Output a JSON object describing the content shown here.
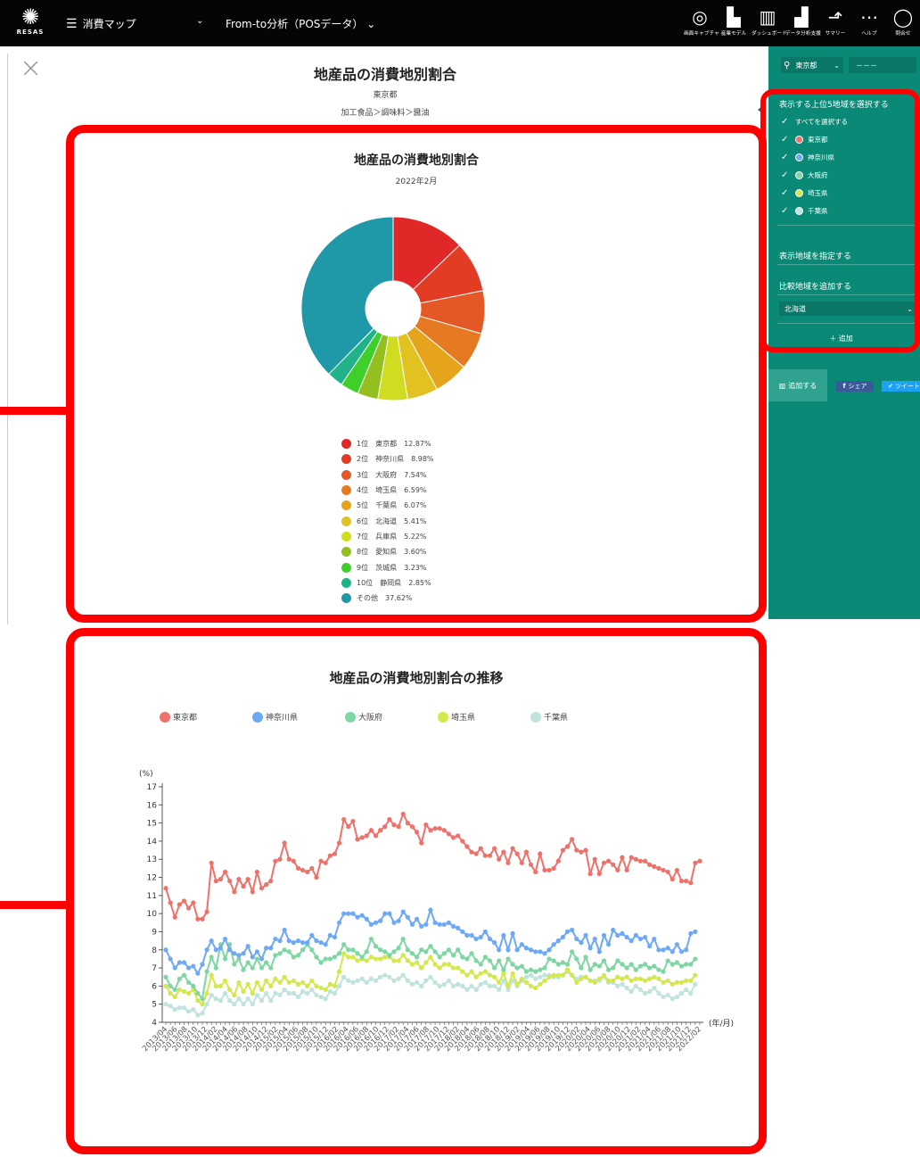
{
  "header": {
    "logo_text": "RESAS",
    "menu_label": "消費マップ",
    "menu_caret": "⌄",
    "submenu_label": "From-to分析（POSデータ） ⌄",
    "tools": [
      {
        "icon": "camera-icon",
        "glyph": "◎",
        "label": "画面キャプチャ"
      },
      {
        "icon": "industry-model-icon",
        "glyph": "▙",
        "label": "産業モデル"
      },
      {
        "icon": "dashboard-icon",
        "glyph": "▥",
        "label": "ダッシュボード"
      },
      {
        "icon": "data-analysis-icon",
        "glyph": "▟",
        "label": "データ分析支援"
      },
      {
        "icon": "summary-icon",
        "glyph": "⬏",
        "label": "サマリー"
      },
      {
        "icon": "help-icon",
        "glyph": "⋯",
        "label": "ヘルプ"
      },
      {
        "icon": "contact-icon",
        "glyph": "◯",
        "label": "問合せ"
      }
    ]
  },
  "page": {
    "close_glyph": "×",
    "title": "地産品の消費地別割合",
    "prefecture": "東京都",
    "breadcrumb": "加工食品＞調味料＞醤油"
  },
  "pie_panel": {
    "title": "地産品の消費地別割合",
    "subtitle": "2022年2月"
  },
  "line_panel": {
    "title": "地産品の消費地別割合の推移"
  },
  "sidebar": {
    "region_icon": "location-pin-icon",
    "region_value": "東京都",
    "region_caret": "⌄",
    "region2_value": "－－－",
    "top5_heading": "表示する上位5地域を選択する",
    "select_all": "すべてを選択する",
    "checkmark": "✓",
    "regions": [
      {
        "name": "東京都",
        "color": "#f0706a"
      },
      {
        "name": "神奈川県",
        "color": "#6fa8f5"
      },
      {
        "name": "大阪府",
        "color": "#7ed6a2"
      },
      {
        "name": "埼玉県",
        "color": "#d4e84a"
      },
      {
        "name": "千葉県",
        "color": "#bfe3dd"
      }
    ],
    "specify_heading": "表示地域を指定する",
    "compare_heading": "比較地域を追加する",
    "compare_select": "北海道",
    "compare_caret": "⌄",
    "add_label": "＋ 追加",
    "add_button": "追加する",
    "share_button": "シェア",
    "tweet_button": "ツイート",
    "share_icon": "f",
    "tweet_icon": "✔"
  },
  "chart_data": [
    {
      "type": "pie",
      "title": "地産品の消費地別割合",
      "subtitle": "2022年2月",
      "donut": true,
      "slices": [
        {
          "rank": "1位",
          "label": "東京都",
          "value": 12.87,
          "display": "12.87%",
          "color": "#e02828"
        },
        {
          "rank": "2位",
          "label": "神奈川県",
          "value": 8.98,
          "display": "8.98%",
          "color": "#e23c25"
        },
        {
          "rank": "3位",
          "label": "大阪府",
          "value": 7.54,
          "display": "7.54%",
          "color": "#e45826"
        },
        {
          "rank": "4位",
          "label": "埼玉県",
          "value": 6.59,
          "display": "6.59%",
          "color": "#e57a22"
        },
        {
          "rank": "5位",
          "label": "千葉県",
          "value": 6.07,
          "display": "6.07%",
          "color": "#e6a41d"
        },
        {
          "rank": "6位",
          "label": "北海道",
          "value": 5.41,
          "display": "5.41%",
          "color": "#e1c220"
        },
        {
          "rank": "7位",
          "label": "兵庫県",
          "value": 5.22,
          "display": "5.22%",
          "color": "#cfdc1f"
        },
        {
          "rank": "8位",
          "label": "愛知県",
          "value": 3.6,
          "display": "3.60%",
          "color": "#93c01f"
        },
        {
          "rank": "9位",
          "label": "茨城県",
          "value": 3.23,
          "display": "3.23%",
          "color": "#3fcf2a"
        },
        {
          "rank": "10位",
          "label": "静岡県",
          "value": 2.85,
          "display": "2.85%",
          "color": "#21b28a"
        },
        {
          "rank": "",
          "label": "その他",
          "value": 37.62,
          "display": "37.62%",
          "color": "#1f98a8"
        }
      ]
    },
    {
      "type": "line",
      "title": "地産品の消費地別割合の推移",
      "ylabel": "(%)",
      "xlabel": "(年/月)",
      "ylim": [
        4,
        17
      ],
      "yticks": [
        4,
        5,
        6,
        7,
        8,
        9,
        10,
        11,
        12,
        13,
        14,
        15,
        16,
        17
      ],
      "x_tick_labels": [
        "2013/04",
        "2013/06",
        "2013/08",
        "2013/10",
        "2013/12",
        "2014/02",
        "2014/04",
        "2014/06",
        "2014/08",
        "2014/10",
        "2014/12",
        "2015/02",
        "2015/04",
        "2015/06",
        "2015/08",
        "2015/10",
        "2015/12",
        "2016/02",
        "2016/04",
        "2016/06",
        "2016/08",
        "2016/10",
        "2016/12",
        "2017/02",
        "2017/04",
        "2017/06",
        "2017/08",
        "2017/10",
        "2017/12",
        "2018/02",
        "2018/04",
        "2018/06",
        "2018/08",
        "2018/10",
        "2018/12",
        "2019/02",
        "2019/04",
        "2019/06",
        "2019/08",
        "2019/10",
        "2019/12",
        "2020/02",
        "2020/04",
        "2020/06",
        "2020/08",
        "2020/10",
        "2020/12",
        "2021/02",
        "2021/04",
        "2021/06",
        "2021/08",
        "2021/10",
        "2021/12",
        "2022/02"
      ],
      "series": [
        {
          "name": "東京都",
          "color": "#f0706a",
          "values": [
            11.4,
            10.6,
            9.8,
            10.5,
            10.7,
            10.3,
            10.6,
            9.7,
            9.7,
            10.1,
            12.8,
            11.8,
            11.9,
            12.3,
            11.8,
            11.2,
            11.9,
            11.5,
            11.9,
            11.2,
            12.3,
            11.4,
            11.6,
            11.8,
            12.9,
            13.0,
            13.9,
            13.0,
            12.9,
            12.5,
            12.4,
            12.3,
            12.5,
            12.0,
            12.9,
            12.8,
            13.2,
            13.3,
            13.9,
            15.2,
            14.8,
            15.1,
            14.1,
            14.2,
            14.3,
            14.6,
            14.3,
            14.6,
            14.8,
            15.2,
            14.9,
            14.8,
            15.5,
            15.0,
            14.8,
            14.5,
            13.9,
            14.9,
            14.6,
            14.7,
            14.7,
            14.6,
            14.4,
            14.2,
            14.3,
            14.0,
            13.7,
            13.4,
            13.3,
            13.6,
            13.2,
            13.2,
            13.6,
            13.0,
            13.4,
            12.8,
            13.6,
            13.3,
            12.8,
            13.4,
            12.7,
            12.3,
            13.3,
            12.4,
            12.4,
            12.5,
            12.9,
            13.5,
            13.7,
            14.1,
            13.5,
            13.4,
            13.5,
            12.2,
            13.0,
            12.2,
            12.8,
            12.9,
            12.7,
            12.4,
            13.1,
            12.4,
            13.1,
            13.0,
            12.9,
            12.9,
            12.7,
            12.6,
            12.5,
            12.4,
            12.3,
            11.9,
            12.4,
            11.8,
            11.8,
            11.7,
            12.8,
            12.9
          ]
        },
        {
          "name": "神奈川県",
          "color": "#6fa8f5",
          "values": [
            8.0,
            7.5,
            7.0,
            7.3,
            7.3,
            7.0,
            7.1,
            6.7,
            7.2,
            8.0,
            8.5,
            8.0,
            8.1,
            8.6,
            8.0,
            7.8,
            7.7,
            7.8,
            8.2,
            7.6,
            7.9,
            7.5,
            8.1,
            8.1,
            8.6,
            8.5,
            9.1,
            8.5,
            8.4,
            8.5,
            8.4,
            8.4,
            8.8,
            8.5,
            8.4,
            8.3,
            8.8,
            8.7,
            9.5,
            10.0,
            10.0,
            10.0,
            9.8,
            9.9,
            9.7,
            9.4,
            9.5,
            9.6,
            10.0,
            10.0,
            9.5,
            9.6,
            10.1,
            9.8,
            9.4,
            9.7,
            9.3,
            9.4,
            10.2,
            9.5,
            9.4,
            9.4,
            9.5,
            9.3,
            9.2,
            9.0,
            8.8,
            8.8,
            8.6,
            8.7,
            9.0,
            8.6,
            8.4,
            8.0,
            8.8,
            8.0,
            8.9,
            8.0,
            8.3,
            8.1,
            8.0,
            7.9,
            7.9,
            7.8,
            8.0,
            8.3,
            8.5,
            8.7,
            9.0,
            9.1,
            8.6,
            8.4,
            8.8,
            8.1,
            8.6,
            7.9,
            8.8,
            8.3,
            9.1,
            8.8,
            8.9,
            8.7,
            8.5,
            8.8,
            8.6,
            8.7,
            8.2,
            8.6,
            8.0,
            8.0,
            8.1,
            7.9,
            8.3,
            7.9,
            8.0,
            8.9,
            9.0
          ]
        },
        {
          "name": "大阪府",
          "color": "#7ed6a2",
          "values": [
            6.5,
            6.0,
            5.8,
            6.4,
            6.6,
            6.2,
            6.0,
            5.6,
            5.3,
            6.8,
            7.6,
            7.0,
            8.3,
            7.5,
            8.3,
            7.2,
            7.5,
            6.9,
            7.3,
            7.0,
            7.5,
            7.0,
            7.3,
            7.0,
            7.7,
            7.8,
            8.0,
            7.9,
            7.6,
            7.7,
            8.0,
            8.3,
            8.0,
            7.6,
            7.3,
            7.5,
            7.5,
            7.6,
            7.8,
            8.3,
            8.0,
            8.0,
            7.8,
            7.6,
            7.9,
            8.6,
            8.2,
            8.0,
            7.9,
            7.7,
            7.9,
            8.1,
            8.6,
            8.0,
            7.8,
            7.6,
            8.0,
            7.9,
            8.2,
            7.9,
            7.6,
            7.8,
            8.0,
            7.7,
            8.0,
            7.6,
            7.5,
            7.8,
            7.4,
            7.2,
            7.6,
            7.4,
            7.0,
            7.4,
            6.9,
            7.5,
            7.2,
            7.0,
            7.1,
            6.8,
            6.9,
            6.8,
            6.9,
            7.0,
            7.5,
            7.4,
            7.2,
            7.3,
            7.2,
            7.9,
            7.5,
            7.0,
            7.6,
            6.9,
            7.2,
            7.1,
            7.4,
            6.9,
            7.0,
            7.4,
            7.2,
            7.0,
            7.2,
            6.9,
            7.1,
            7.2,
            7.0,
            7.1,
            6.9,
            6.8,
            7.4,
            7.2,
            7.3,
            7.1,
            7.2,
            7.2,
            7.5
          ]
        },
        {
          "name": "埼玉県",
          "color": "#d4e84a",
          "values": [
            6.0,
            5.6,
            5.4,
            5.8,
            5.7,
            5.6,
            5.8,
            5.2,
            5.0,
            5.6,
            6.6,
            6.0,
            6.0,
            6.3,
            5.8,
            5.5,
            6.2,
            5.7,
            6.1,
            5.6,
            6.2,
            5.8,
            6.3,
            6.0,
            6.4,
            6.2,
            6.5,
            6.2,
            6.3,
            6.1,
            6.2,
            6.0,
            6.3,
            6.0,
            5.9,
            5.8,
            6.1,
            6.0,
            6.8,
            7.8,
            7.6,
            7.6,
            7.4,
            7.5,
            7.4,
            7.6,
            7.5,
            7.5,
            7.6,
            7.6,
            7.4,
            7.4,
            7.7,
            7.4,
            7.2,
            7.3,
            7.0,
            7.3,
            7.6,
            7.2,
            7.0,
            7.2,
            7.2,
            7.0,
            7.0,
            6.8,
            6.6,
            6.8,
            6.5,
            6.7,
            6.8,
            6.6,
            6.5,
            6.2,
            6.7,
            6.0,
            6.7,
            6.1,
            6.4,
            6.2,
            6.0,
            5.9,
            6.1,
            6.3,
            6.5,
            6.6,
            6.6,
            6.6,
            6.9,
            6.6,
            6.2,
            6.4,
            6.5,
            6.3,
            6.2,
            6.4,
            6.6,
            6.3,
            6.3,
            6.5,
            6.4,
            6.5,
            6.3,
            6.4,
            6.4,
            6.3,
            6.4,
            6.5,
            6.4,
            6.2,
            6.3,
            6.1,
            6.2,
            6.2,
            6.3,
            6.3,
            6.6
          ]
        },
        {
          "name": "千葉県",
          "color": "#bfe3dd",
          "values": [
            5.0,
            4.9,
            4.7,
            4.8,
            4.8,
            4.6,
            4.7,
            4.4,
            4.5,
            5.0,
            5.5,
            5.3,
            5.2,
            5.6,
            5.2,
            5.0,
            5.3,
            5.0,
            5.3,
            5.0,
            5.5,
            5.2,
            5.6,
            5.2,
            5.6,
            5.5,
            5.8,
            5.6,
            5.6,
            5.4,
            5.7,
            5.6,
            5.8,
            5.5,
            5.4,
            5.3,
            5.7,
            5.6,
            6.0,
            6.5,
            6.3,
            6.2,
            6.3,
            6.4,
            6.2,
            6.4,
            6.3,
            6.5,
            6.6,
            6.5,
            6.3,
            6.4,
            6.6,
            6.3,
            6.1,
            6.2,
            6.0,
            6.3,
            6.5,
            6.2,
            6.0,
            6.1,
            6.3,
            6.0,
            6.1,
            6.0,
            5.8,
            6.0,
            5.8,
            6.1,
            6.2,
            6.0,
            6.0,
            5.8,
            6.3,
            5.8,
            6.3,
            6.0,
            6.3,
            6.5,
            6.6,
            6.4,
            6.5,
            6.6,
            6.6,
            6.5,
            6.5,
            6.6,
            6.8,
            6.6,
            6.4,
            6.5,
            6.5,
            6.3,
            6.3,
            6.3,
            6.5,
            6.2,
            6.2,
            6.0,
            6.1,
            5.9,
            5.7,
            6.0,
            5.8,
            5.6,
            5.7,
            5.9,
            5.6,
            5.4,
            5.5,
            5.3,
            5.4,
            5.6,
            5.8,
            5.6,
            6.1
          ]
        }
      ]
    }
  ]
}
